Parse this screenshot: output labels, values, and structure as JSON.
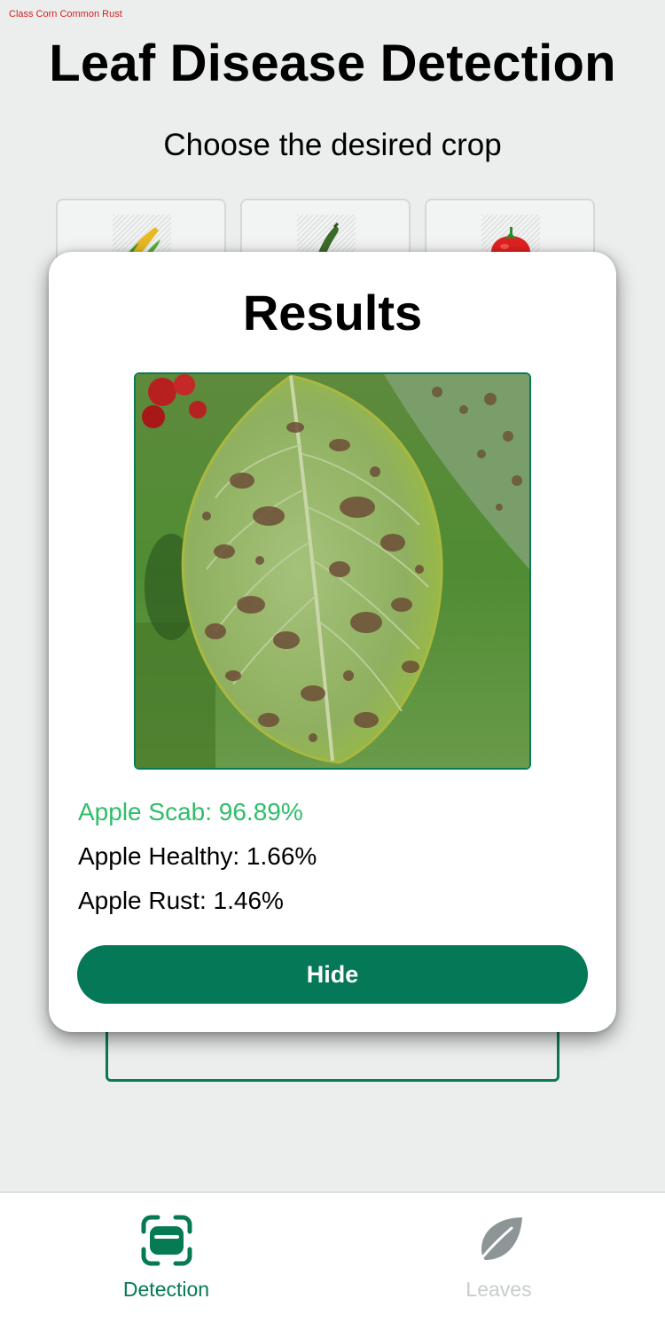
{
  "debug": {
    "class_label": "Class Corn Common Rust"
  },
  "header": {
    "title": "Leaf Disease Detection",
    "subtitle": "Choose the desired crop"
  },
  "crops": [
    {
      "icon": "corn-icon"
    },
    {
      "icon": "cucumber-icon"
    },
    {
      "icon": "tomato-icon"
    }
  ],
  "modal": {
    "title": "Results",
    "image_icon": "diseased-apple-leaf-photo",
    "results": [
      {
        "text": "Apple Scab: 96.89%",
        "label": "Apple Scab",
        "percent": 96.89
      },
      {
        "text": "Apple Healthy: 1.66%",
        "label": "Apple Healthy",
        "percent": 1.66
      },
      {
        "text": "Apple Rust: 1.46%",
        "label": "Apple Rust",
        "percent": 1.46
      }
    ],
    "hide_label": "Hide"
  },
  "tabs": [
    {
      "label": "Detection",
      "icon": "scan-icon",
      "active": true
    },
    {
      "label": "Leaves",
      "icon": "leaf-icon",
      "active": false
    }
  ],
  "colors": {
    "accent": "#047857",
    "top_result": "#2fbd6a",
    "background": "#eceeee",
    "inactive_tab": "#c7cccd"
  }
}
